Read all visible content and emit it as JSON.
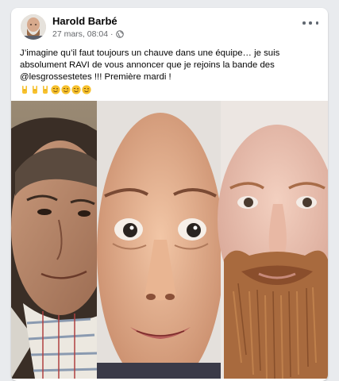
{
  "post": {
    "author": "Harold Barbé",
    "timestamp": "27 mars, 08:04",
    "separator": "·",
    "privacy_icon": "globe-icon",
    "menu_icon": "more-options-icon",
    "text_lines": [
      "J’imagine qu’il faut toujours un chauve dans une équipe…  je suis",
      "absolument RAVI de vous annoncer que je rejoins la bande des",
      "@lesgrossestetes !!! Première mardi !"
    ],
    "emojis": [
      "sign-of-horns",
      "sign-of-horns",
      "sign-of-horns",
      "winking-face",
      "winking-face",
      "winking-face",
      "winking-face"
    ],
    "photo": {
      "description_icons": [
        "portrait-older-man",
        "portrait-bald-man-smiling",
        "portrait-bald-bearded-man"
      ]
    }
  },
  "colors": {
    "page_background": "#e9ebee",
    "card_background": "#ffffff",
    "text_primary": "#050505",
    "text_secondary": "#65676b",
    "emoji_yellow": "#f7c12d"
  }
}
